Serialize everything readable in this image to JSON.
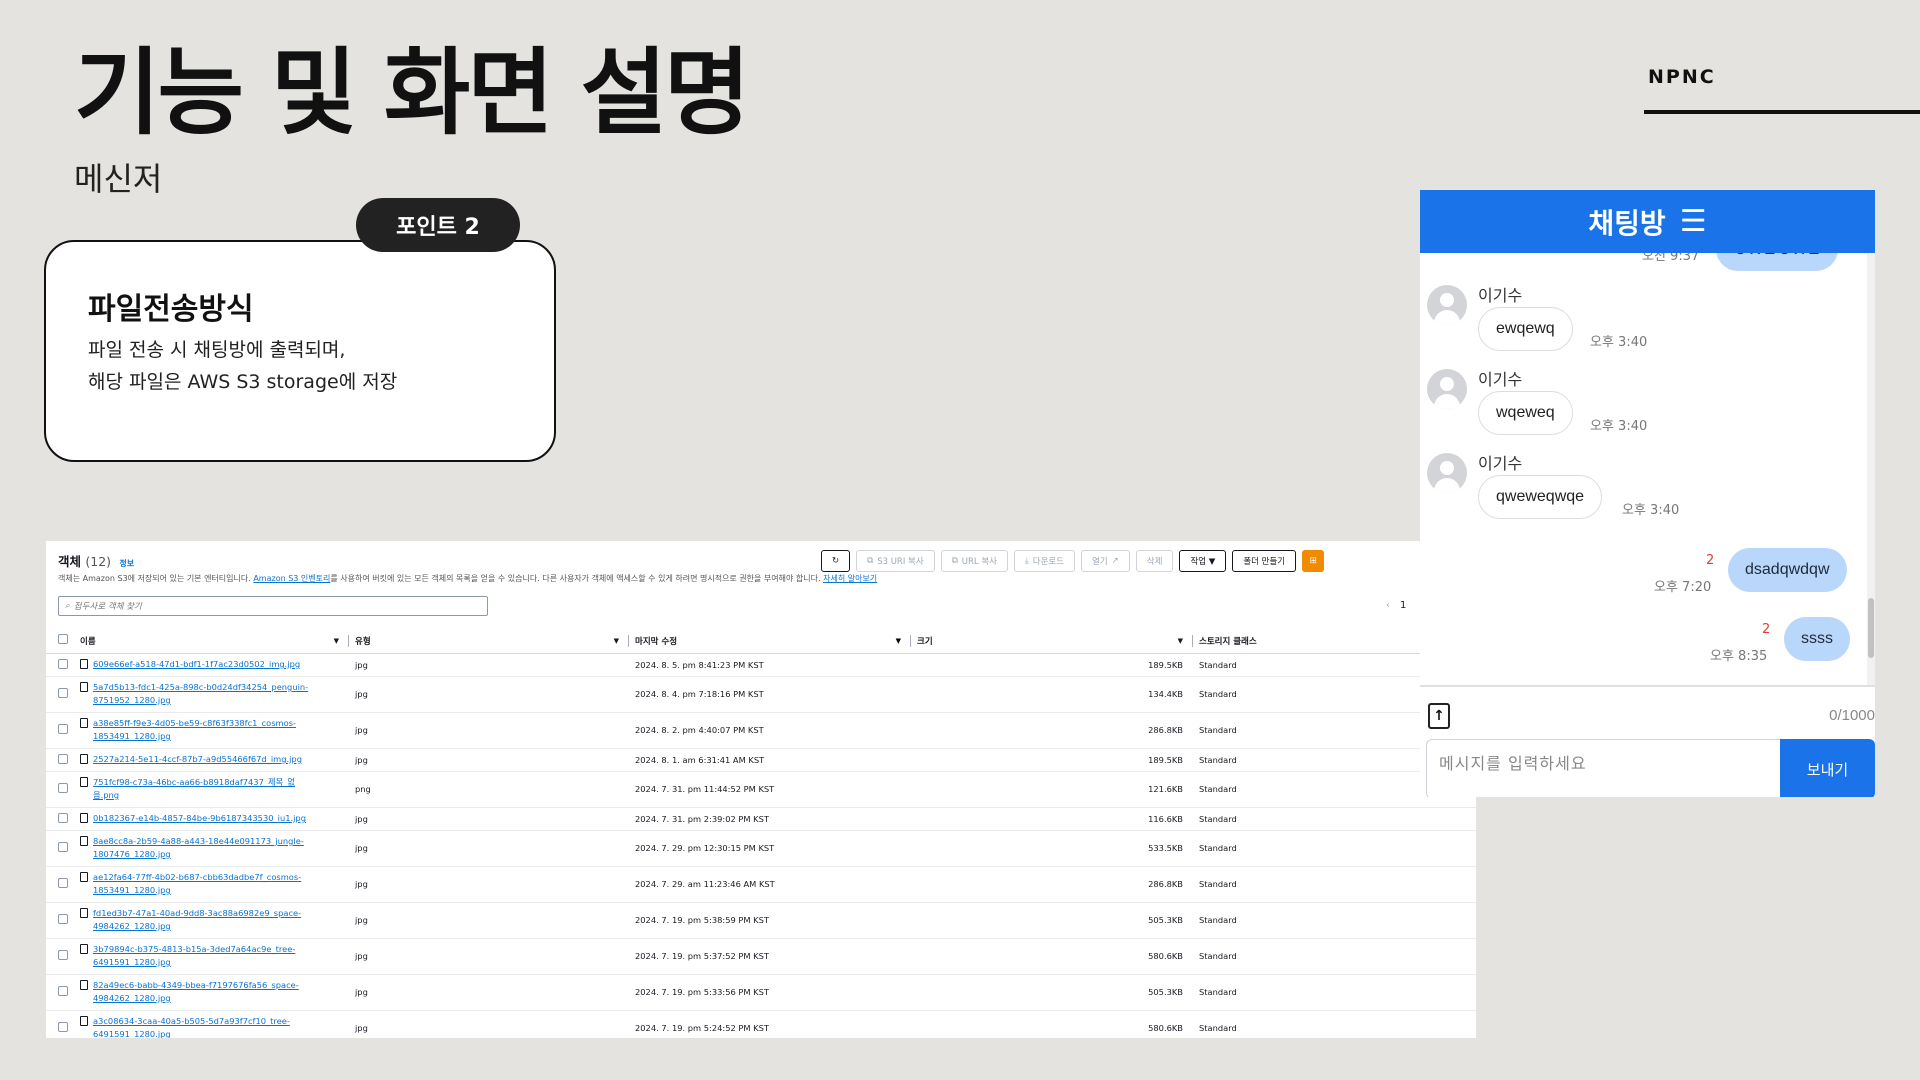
{
  "slide": {
    "title": "기능 및 화면 설명",
    "subtitle": "메신저",
    "brand": "NPNC"
  },
  "point": {
    "badge": "포인트 2",
    "heading": "파일전송방식",
    "line1": "파일 전송 시 채팅방에 출력되며,",
    "line2": "해당 파일은 AWS S3 storage에 저장"
  },
  "s3": {
    "heading": "객체",
    "count": "(12)",
    "info": "정보",
    "desc_pre": "객체는 Amazon S3에 저장되어 있는 기본 엔터티입니다.",
    "desc_link1": "Amazon S3 인벤토리",
    "desc_mid": "를 사용하여 버킷에 있는 모든 객체의 목록을 얻을 수 있습니다. 다른 사용자가 객체에 액세스할 수 있게 하려면 명시적으로 권한을 부여해야 합니다.",
    "desc_link2": "자세히 알아보기",
    "toolbar": {
      "refresh": "↻",
      "copy_s3_uri": "S3 URI 복사",
      "copy_url": "URL 복사",
      "download": "다운로드",
      "open": "열기",
      "delete": "삭제",
      "actions": "작업 ▼",
      "create_folder": "폴더 만들기",
      "upload": "⊞"
    },
    "search_placeholder": "접두사로 객체 찾기",
    "pager": {
      "prev": "‹",
      "page": "1"
    },
    "columns": {
      "name": "이름",
      "type": "유형",
      "modified": "마지막 수정",
      "size": "크기",
      "storage": "스토리지 클래스"
    },
    "rows": [
      {
        "name1": "609e66ef-a518-47d1-bdf1-1f7ac23d0502_img.jpg",
        "name2": "",
        "type": "jpg",
        "modified": "2024. 8. 5. pm 8:41:23 PM KST",
        "size": "189.5KB",
        "storage": "Standard"
      },
      {
        "name1": "5a7d5b13-fdc1-425a-898c-b0d24df34254_penguin-",
        "name2": "8751952_1280.jpg",
        "type": "jpg",
        "modified": "2024. 8. 4. pm 7:18:16 PM KST",
        "size": "134.4KB",
        "storage": "Standard"
      },
      {
        "name1": "a38e85ff-f9e3-4d05-be59-c8f63f338fc1_cosmos-",
        "name2": "1853491_1280.jpg",
        "type": "jpg",
        "modified": "2024. 8. 2. pm 4:40:07 PM KST",
        "size": "286.8KB",
        "storage": "Standard"
      },
      {
        "name1": "2527a214-5e11-4ccf-87b7-a9d55466f67d_img.jpg",
        "name2": "",
        "type": "jpg",
        "modified": "2024. 8. 1. am 6:31:41 AM KST",
        "size": "189.5KB",
        "storage": "Standard"
      },
      {
        "name1": "751fcf98-c73a-46bc-aa66-b8918daf7437_제목_없",
        "name2": "음.png",
        "type": "png",
        "modified": "2024. 7. 31. pm 11:44:52 PM KST",
        "size": "121.6KB",
        "storage": "Standard"
      },
      {
        "name1": "0b182367-e14b-4857-84be-9b6187343530_iu1.jpg",
        "name2": "",
        "type": "jpg",
        "modified": "2024. 7. 31. pm 2:39:02 PM KST",
        "size": "116.6KB",
        "storage": "Standard"
      },
      {
        "name1": "8ae8cc8a-2b59-4a88-a443-18e44e091173_jungle-",
        "name2": "1807476_1280.jpg",
        "type": "jpg",
        "modified": "2024. 7. 29. pm 12:30:15 PM KST",
        "size": "533.5KB",
        "storage": "Standard"
      },
      {
        "name1": "ae12fa64-77ff-4b02-b687-cbb63dadbe7f_cosmos-",
        "name2": "1853491_1280.jpg",
        "type": "jpg",
        "modified": "2024. 7. 29. am 11:23:46 AM KST",
        "size": "286.8KB",
        "storage": "Standard"
      },
      {
        "name1": "fd1ed3b7-47a1-40ad-9dd8-3ac88a6982e9_space-",
        "name2": "4984262_1280.jpg",
        "type": "jpg",
        "modified": "2024. 7. 19. pm 5:38:59 PM KST",
        "size": "505.3KB",
        "storage": "Standard"
      },
      {
        "name1": "3b79894c-b375-4813-b15a-3ded7a64ac9e_tree-",
        "name2": "6491591_1280.jpg",
        "type": "jpg",
        "modified": "2024. 7. 19. pm 5:37:52 PM KST",
        "size": "580.6KB",
        "storage": "Standard"
      },
      {
        "name1": "82a49ec6-babb-4349-bbea-f7197676fa56_space-",
        "name2": "4984262_1280.jpg",
        "type": "jpg",
        "modified": "2024. 7. 19. pm 5:33:56 PM KST",
        "size": "505.3KB",
        "storage": "Standard"
      },
      {
        "name1": "a3c08634-3caa-40a5-b505-5d7a93f7cf10_tree-",
        "name2": "6491591_1280.jpg",
        "type": "jpg",
        "modified": "2024. 7. 19. pm 5:24:52 PM KST",
        "size": "580.6KB",
        "storage": "Standard"
      }
    ]
  },
  "chat": {
    "title": "채팅방",
    "menu_icon": "☰",
    "partial_time": "오전 9:37",
    "partial_text": "ㅇㅈㅂㅇㅈㅂ",
    "messages": [
      {
        "sender": "이기수",
        "text": "ewqewq",
        "time": "오후 3:40"
      },
      {
        "sender": "이기수",
        "text": "wqeweq",
        "time": "오후 3:40"
      },
      {
        "sender": "이기수",
        "text": "qweweqwqe",
        "time": "오후 3:40"
      }
    ],
    "mine": [
      {
        "unread": "2",
        "text": "dsadqwdqw",
        "time": "오후 7:20"
      },
      {
        "unread": "2",
        "text": "ssss",
        "time": "오후 8:35"
      }
    ],
    "counter": "0/1000",
    "input_placeholder": "메시지를 입력하세요",
    "send": "보내기"
  }
}
